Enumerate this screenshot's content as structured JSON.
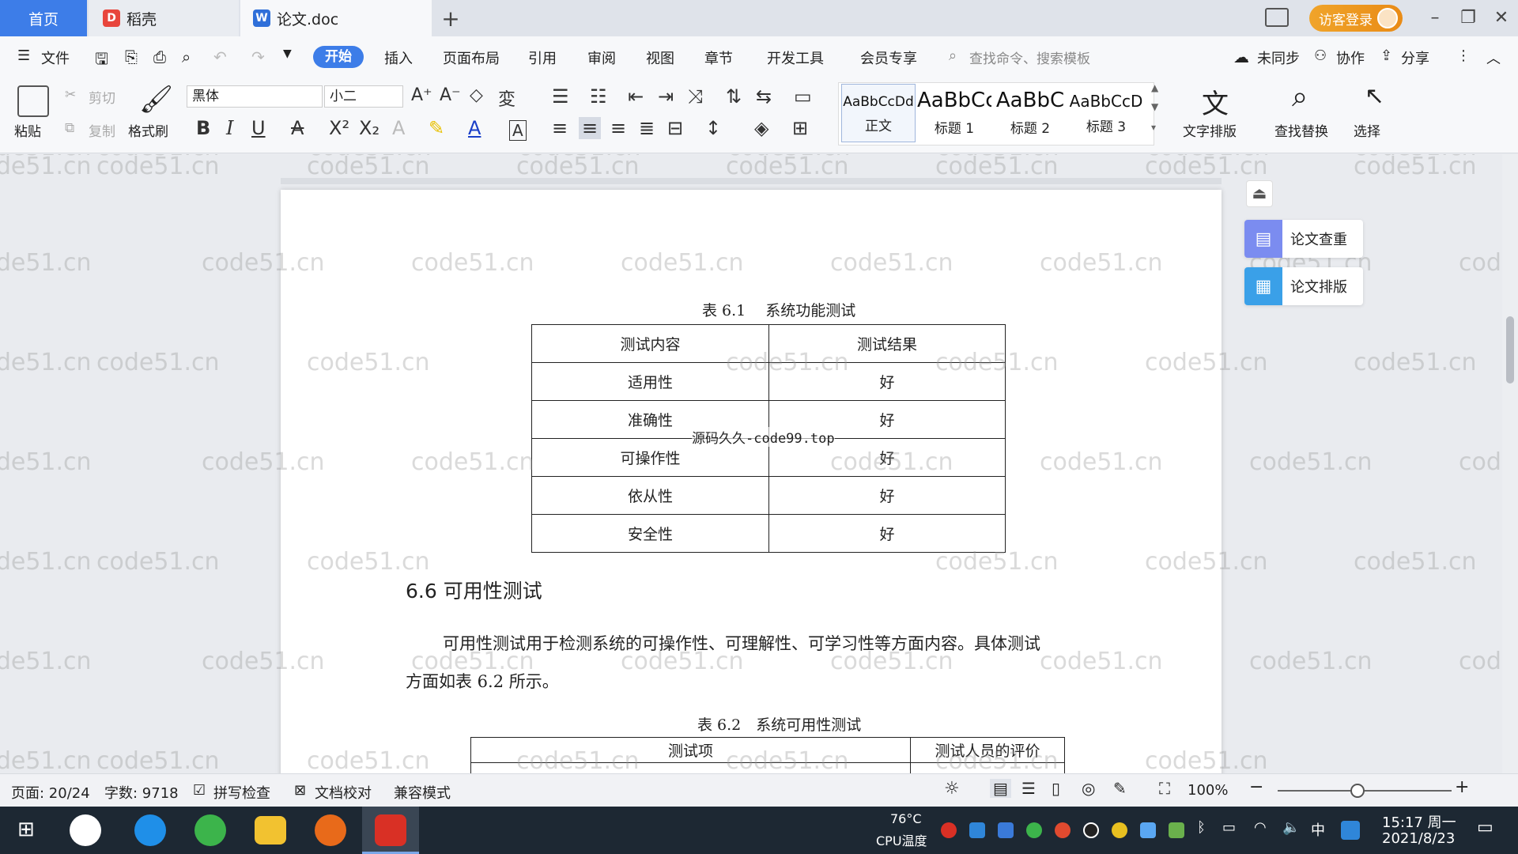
{
  "tabs": {
    "home": "首页",
    "daoke": "稻壳",
    "doc": "论文.doc",
    "add": "+"
  },
  "titlebar": {
    "login": "访客登录"
  },
  "menu": {
    "file": "文件",
    "start": "开始",
    "items": [
      "插入",
      "页面布局",
      "引用",
      "审阅",
      "视图",
      "章节",
      "开发工具",
      "会员专享"
    ],
    "search_placeholder": "查找命令、搜索模板",
    "sync": "未同步",
    "collab": "协作",
    "share": "分享"
  },
  "ribbon": {
    "paste": "粘贴",
    "cut": "剪切",
    "copy": "复制",
    "format_painter": "格式刷",
    "font_name": "黑体",
    "font_size": "小二",
    "styles": [
      {
        "sample": "AaBbCcDd",
        "name": "正文"
      },
      {
        "sample": "AaBbCc",
        "name": "标题 1"
      },
      {
        "sample": "AaBbC",
        "name": "标题 2"
      },
      {
        "sample": "AaBbCcD",
        "name": "标题 3"
      }
    ],
    "text_layout": "文字排版",
    "find_replace": "查找替换",
    "select": "选择"
  },
  "document": {
    "table1_caption": "表 6.1　 系统功能测试",
    "table1_headers": [
      "测试内容",
      "测试结果"
    ],
    "table1_rows": [
      [
        "适用性",
        "好"
      ],
      [
        "准确性",
        "好"
      ],
      [
        "可操作性",
        "好"
      ],
      [
        "依从性",
        "好"
      ],
      [
        "安全性",
        "好"
      ]
    ],
    "overlay_watermark": "源码久久-code99.top",
    "section_heading": "6.6 可用性测试",
    "paragraph_line1": "可用性测试用于检测系统的可操作性、可理解性、可学习性等方面内容。具体测试",
    "paragraph_line2": "方面如表 6.2 所示。",
    "table2_caption": "表 6.2　系统可用性测试",
    "table2_headers": [
      "测试项",
      "测试人员的评价"
    ],
    "watermark": "code51.cn"
  },
  "sidepanel": {
    "check": "论文查重",
    "layout": "论文排版"
  },
  "status": {
    "page": "页面: 20/24",
    "words": "字数: 9718",
    "spell": "拼写检查",
    "proof": "文档校对",
    "compat": "兼容模式",
    "zoom": "100%"
  },
  "taskbar": {
    "cpu_temp": "76°C",
    "cpu_label": "CPU温度",
    "ime": "中",
    "time": "15:17 周一",
    "date": "2021/8/23"
  }
}
